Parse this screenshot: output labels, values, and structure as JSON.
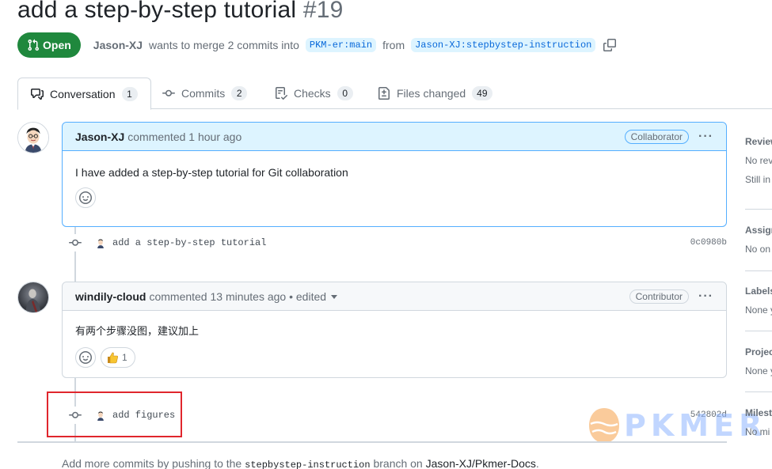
{
  "pr": {
    "title": "add a step-by-step tutorial",
    "number": "#19",
    "state": "Open",
    "author": "Jason-XJ",
    "merge_text": "wants to merge 2 commits into",
    "base_branch": "PKM-er:main",
    "from_text": "from",
    "head_branch": "Jason-XJ:stepbystep-instruction"
  },
  "tabs": [
    {
      "label": "Conversation",
      "count": "1"
    },
    {
      "label": "Commits",
      "count": "2"
    },
    {
      "label": "Checks",
      "count": "0"
    },
    {
      "label": "Files changed",
      "count": "49"
    }
  ],
  "timeline": {
    "comment1": {
      "author": "Jason-XJ",
      "meta": "commented 1 hour ago",
      "role": "Collaborator",
      "body": "I have added a step-by-step tutorial for Git collaboration"
    },
    "commit1": {
      "message": "add a step-by-step tutorial",
      "sha": "0c0980b"
    },
    "comment2": {
      "author": "windily-cloud",
      "meta": "commented 13 minutes ago • edited",
      "role": "Contributor",
      "body": "有两个步骤没图，建议加上",
      "thumbs_count": "1"
    },
    "commit2": {
      "message": "add figures",
      "sha": "542802d"
    }
  },
  "footer": {
    "prefix": "Add more commits by pushing to the",
    "branch": "stepbystep-instruction",
    "mid": "branch on",
    "repo": "Jason-XJ/Pkmer-Docs",
    "suffix": "."
  },
  "sidebar": [
    {
      "heading": "Review",
      "values": [
        "No rev",
        "Still in"
      ]
    },
    {
      "heading": "Assign",
      "values": [
        "No on"
      ]
    },
    {
      "heading": "Labels",
      "values": [
        "None y"
      ]
    },
    {
      "heading": "Projec",
      "values": [
        "None y"
      ]
    },
    {
      "heading": "Milest",
      "values": [
        "No mi"
      ]
    }
  ],
  "watermark": {
    "text": "PKMER"
  },
  "colors": {
    "open_green": "#1f883d",
    "accent_blue": "#0969da",
    "highlight_red": "#e0262d"
  }
}
